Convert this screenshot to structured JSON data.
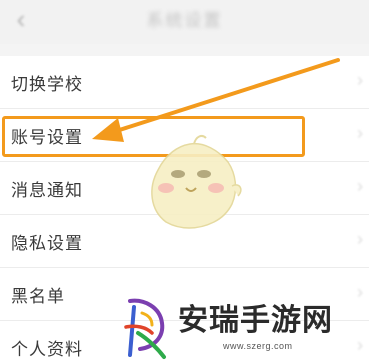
{
  "header": {
    "title": "系统设置",
    "back_icon": "chevron-left-icon"
  },
  "menu": {
    "items": [
      {
        "label": "切换学校"
      },
      {
        "label": "账号设置"
      },
      {
        "label": "消息通知"
      },
      {
        "label": "隐私设置"
      },
      {
        "label": "黑名单"
      },
      {
        "label": "个人资料"
      }
    ]
  },
  "annotation": {
    "highlight_color": "#f39a1c",
    "arrow_color": "#f39a1c"
  },
  "watermark": {
    "name": "安瑞手游网",
    "url": "www.szerg.com"
  }
}
